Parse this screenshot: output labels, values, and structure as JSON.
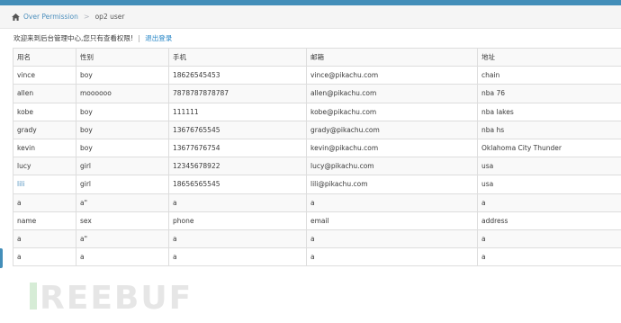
{
  "breadcrumb": {
    "parent": "Over Permission",
    "separator": ">",
    "current": "op2 user"
  },
  "welcome": {
    "message": "欢迎来到后台管理中心,您只有查看权限!",
    "separator": "|",
    "logout": "退出登录"
  },
  "table": {
    "headers": [
      "用名",
      "性别",
      "手机",
      "邮箱",
      "地址"
    ],
    "rows": [
      [
        "vince",
        "boy",
        "18626545453",
        "vince@pikachu.com",
        "chain"
      ],
      [
        "allen",
        "moooooo",
        "7878787878787",
        "allen@pikachu.com",
        "nba 76"
      ],
      [
        "kobe",
        "boy",
        "111111",
        "kobe@pikachu.com",
        "nba lakes"
      ],
      [
        "grady",
        "boy",
        "13676765545",
        "grady@pikachu.com",
        "nba hs"
      ],
      [
        "kevin",
        "boy",
        "13677676754",
        "kevin@pikachu.com",
        "Oklahoma City Thunder"
      ],
      [
        "lucy",
        "girl",
        "12345678922",
        "lucy@pikachu.com",
        "usa"
      ],
      [
        "lili",
        "girl",
        "18656565545",
        "lili@pikachu.com",
        "usa"
      ],
      [
        "a",
        "a\"",
        "a",
        "a",
        "a"
      ],
      [
        "name",
        "sex",
        "phone",
        "email",
        "address"
      ],
      [
        "a",
        "a\"",
        "a",
        "a",
        "a"
      ],
      [
        "a",
        "a",
        "a",
        "a",
        "a"
      ]
    ]
  },
  "watermark": "REEBUF",
  "colors": {
    "topbar": "#438eb9",
    "link": "#4c8fbd",
    "border": "#dddddd",
    "stripe": "#f9f9f9"
  },
  "icons": [
    "home-icon"
  ]
}
